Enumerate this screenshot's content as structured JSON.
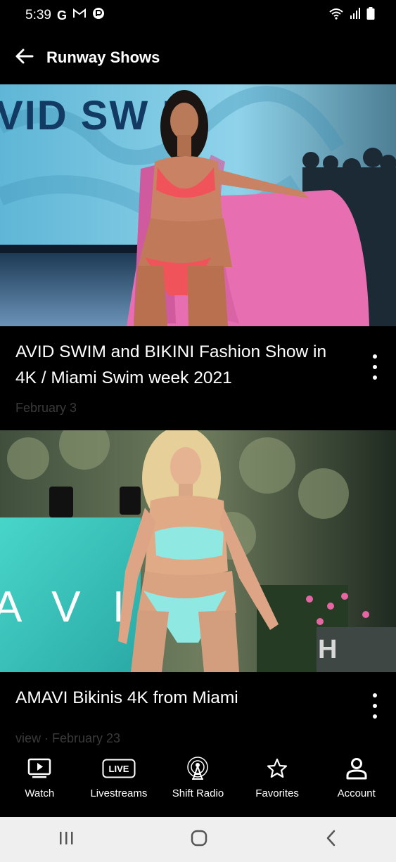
{
  "status_bar": {
    "time": "5:39",
    "icons": [
      "google-icon",
      "gmail-icon",
      "app-notification-icon",
      "wifi-icon",
      "signal-icon",
      "battery-icon"
    ]
  },
  "header": {
    "title": "Runway Shows",
    "back_icon": "arrow-left-icon"
  },
  "videos": [
    {
      "title": "AVID SWIM and BIKINI Fashion Show in 4K / Miami Swim week 2021",
      "date": "February 3",
      "thumbnail_banner": "VID SW  M",
      "thumbnail_description": "model in coral bikini with pink sarong on runway"
    },
    {
      "title": "AMAVI Bikinis 4K from Miami",
      "date": "view · February 23",
      "thumbnail_banner": "A V I",
      "thumbnail_description": "model in mint bikini on runway"
    }
  ],
  "bottom_nav": {
    "items": [
      {
        "label": "Watch",
        "icon": "tv-play-icon"
      },
      {
        "label": "Livestreams",
        "icon": "live-badge-icon"
      },
      {
        "label": "Shift Radio",
        "icon": "radio-tower-icon"
      },
      {
        "label": "Favorites",
        "icon": "star-icon"
      },
      {
        "label": "Account",
        "icon": "person-icon"
      }
    ],
    "live_badge_text": "LIVE"
  },
  "system_nav": {
    "icons": [
      "recent-apps-icon",
      "home-icon",
      "back-nav-icon"
    ]
  },
  "colors": {
    "background": "#000000",
    "date_text": "#3a3a3a",
    "system_nav_bg": "#efefef"
  }
}
